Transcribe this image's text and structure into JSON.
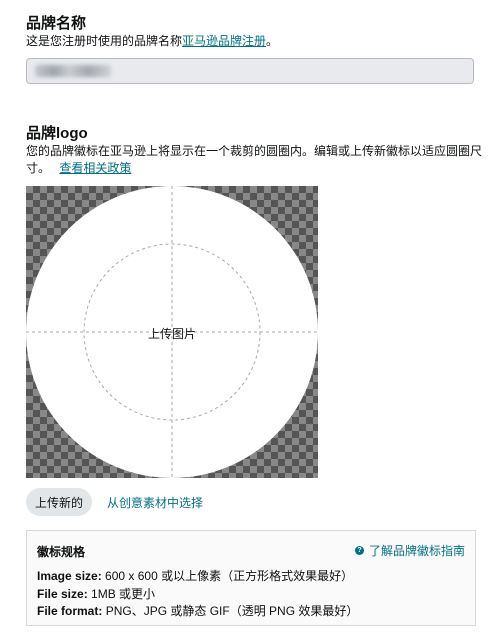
{
  "brand_name": {
    "title": "品牌名称",
    "desc_prefix": "这是您注册时使用的品牌名称",
    "desc_link": "亚马逊品牌注册",
    "desc_suffix": "。",
    "input_value": ""
  },
  "brand_logo": {
    "title": "品牌logo",
    "desc_line1": "您的品牌徽标在亚马逊上将显示在一个裁剪的圆圈内。编辑或上传新徽标以适应圆圈尺",
    "desc_line2": "寸。",
    "policy_link": "查看相关政策",
    "upload_placeholder": "上传图片",
    "upload_new_button": "上传新的",
    "choose_from_assets": "从创意素材中选择"
  },
  "spec": {
    "title": "徽标规格",
    "guide_link": "了解品牌徽标指南",
    "help_icon_glyph": "?",
    "lines": [
      {
        "label": "Image size:",
        "value": "600 x 600 或以上像素（正方形格式效果最好）"
      },
      {
        "label": "File size:",
        "value": "1MB 或更小"
      },
      {
        "label": "File format:",
        "value": "PNG、JPG 或静态 GIF（透明 PNG 效果最好）"
      }
    ]
  },
  "colors": {
    "link": "#007185",
    "checker_dark": "#555555",
    "checker_light": "#888888",
    "input_bg": "#e8eaee"
  }
}
